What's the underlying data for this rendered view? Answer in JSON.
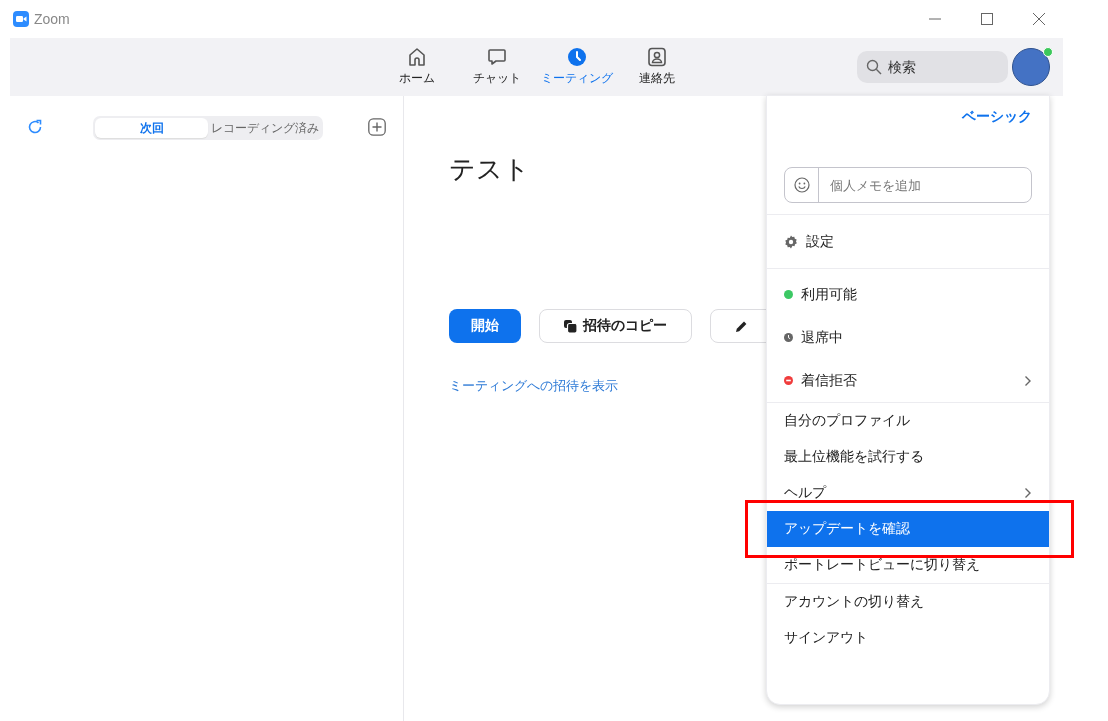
{
  "window": {
    "title": "Zoom"
  },
  "nav_tabs": [
    {
      "label": "ホーム",
      "selected": false
    },
    {
      "label": "チャット",
      "selected": false
    },
    {
      "label": "ミーティング",
      "selected": true
    },
    {
      "label": "連絡先",
      "selected": false
    }
  ],
  "search": {
    "placeholder": "検索"
  },
  "segments": [
    {
      "label": "次回",
      "selected": true
    },
    {
      "label": "レコーディング済み",
      "selected": false
    }
  ],
  "meeting": {
    "title": "テスト",
    "buttons": [
      {
        "kind": "primary",
        "label": "開始"
      },
      {
        "kind": "copy",
        "label": "招待のコピー"
      },
      {
        "kind": "edit"
      }
    ],
    "invite_link": "ミーティングへの招待を表示"
  },
  "menu": {
    "plan": "ベーシック",
    "memo": {
      "placeholder": "個人メモを追加"
    },
    "sections": [
      [
        {
          "kind": "settings",
          "label": "設定",
          "selected": false,
          "submenu": false
        }
      ],
      [
        {
          "kind": "available",
          "label": "利用可能",
          "selected": false,
          "submenu": false
        },
        {
          "kind": "away",
          "label": "退席中",
          "selected": false,
          "submenu": false
        },
        {
          "kind": "busy",
          "label": "着信拒否",
          "selected": false,
          "submenu": true
        }
      ],
      [
        {
          "kind": "plain",
          "label": "自分のプロファイル",
          "selected": false,
          "submenu": false
        },
        {
          "kind": "plain",
          "label": "最上位機能を試行する",
          "selected": false,
          "submenu": false
        },
        {
          "kind": "plain",
          "label": "ヘルプ",
          "selected": false,
          "submenu": true
        },
        {
          "kind": "plain",
          "label": "アップデートを確認",
          "selected": true,
          "submenu": false
        },
        {
          "kind": "plain",
          "label": "ポートレートビューに切り替え",
          "selected": false,
          "submenu": false
        }
      ],
      [
        {
          "kind": "plain",
          "label": "アカウントの切り替え",
          "selected": false,
          "submenu": false
        },
        {
          "kind": "plain",
          "label": "サインアウト",
          "selected": false,
          "submenu": false
        }
      ]
    ]
  },
  "annotation": {
    "kind": "rectangle"
  }
}
